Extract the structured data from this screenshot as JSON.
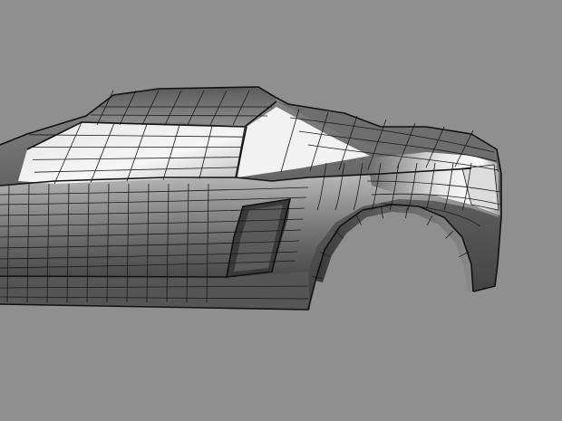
{
  "viewport": {
    "background": "#8f8f8f",
    "shading": "wireframe-on-shaded",
    "wire_color": "#1a1a1a",
    "body_dark": "#3c3c3c",
    "body_mid": "#7a7a7a",
    "body_light": "#d8d8d8",
    "highlight": "#f4f4f4"
  },
  "model": {
    "name_icon": "car-body-mesh",
    "view": "perspective-side"
  }
}
